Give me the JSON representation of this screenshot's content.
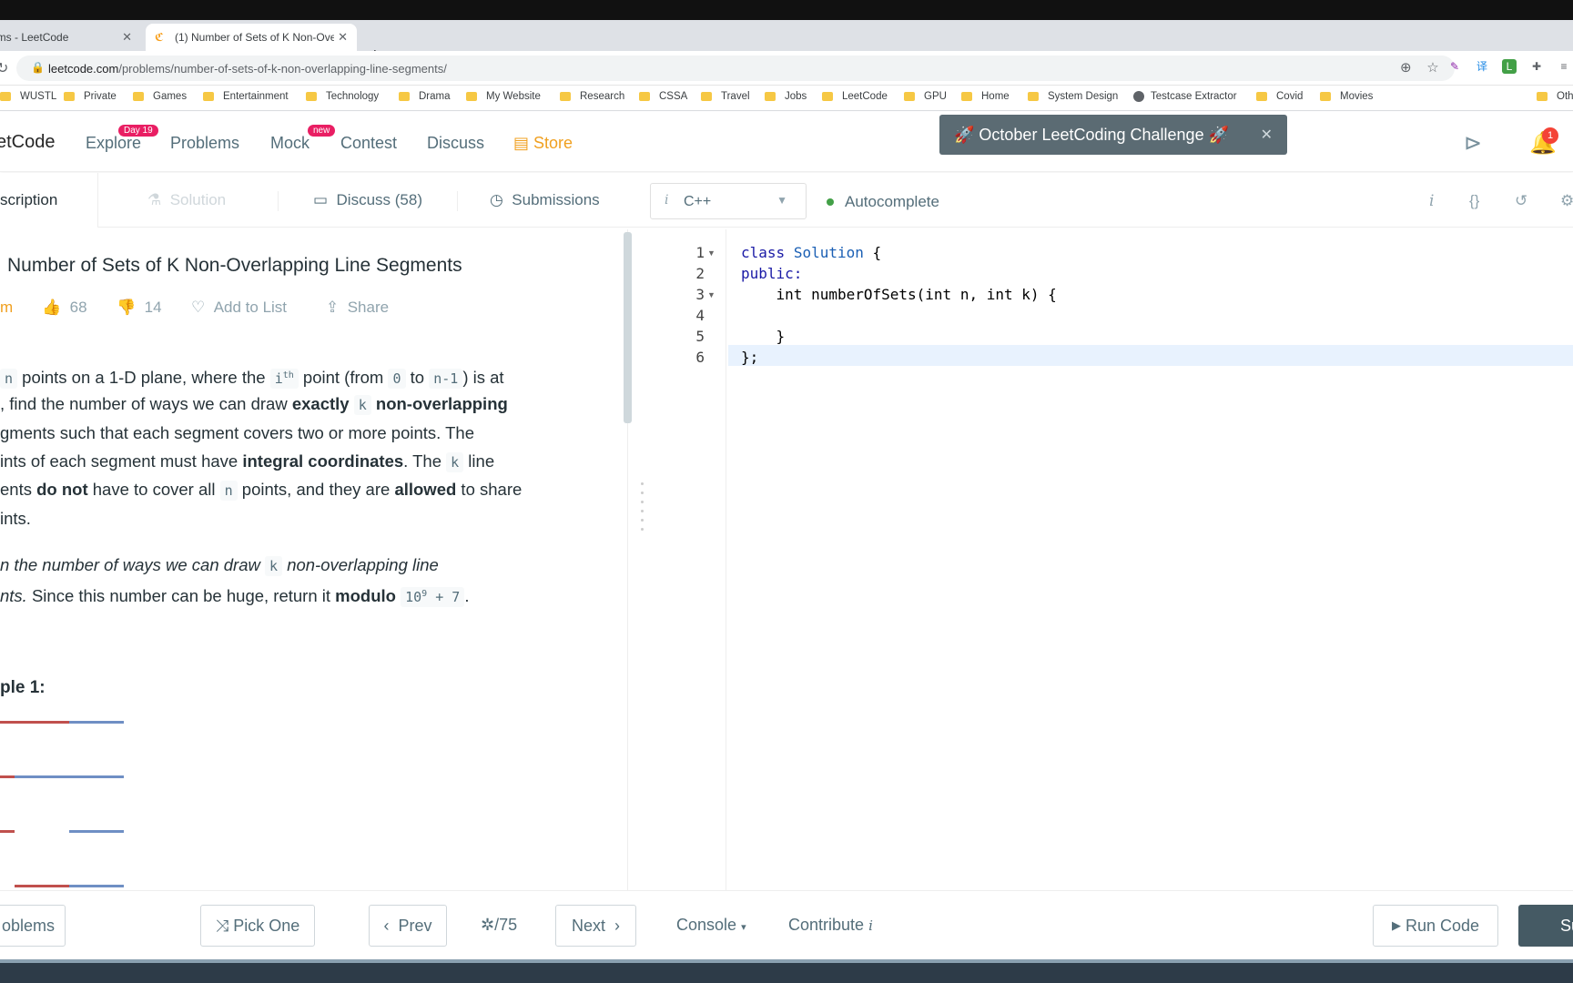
{
  "browser": {
    "tabs": [
      {
        "title": "ems - LeetCode",
        "active": false
      },
      {
        "title": "(1) Number of Sets of K Non-Ove",
        "active": true
      }
    ],
    "url_domain": "leetcode.com",
    "url_path": "/problems/number-of-sets-of-k-non-overlapping-line-segments/",
    "bookmarks": [
      "WUSTL",
      "Private",
      "Games",
      "Entertainment",
      "Technology",
      "Drama",
      "My Website",
      "Research",
      "CSSA",
      "Travel",
      "Jobs",
      "LeetCode",
      "GPU",
      "Home",
      "System Design",
      "Testcase Extractor",
      "Covid",
      "Movies",
      "Oth"
    ]
  },
  "nav": {
    "logo": "etCode",
    "items": [
      "Explore",
      "Problems",
      "Mock",
      "Contest",
      "Discuss"
    ],
    "explore_badge": "Day 19",
    "mock_badge": "new",
    "store": "Store",
    "banner": "🚀 October LeetCoding Challenge 🚀",
    "notifications": "1"
  },
  "tabs": {
    "description": "scription",
    "solution": "Solution",
    "discuss": "Discuss (58)",
    "submissions": "Submissions",
    "language": "C++",
    "autocomplete": "Autocomplete"
  },
  "problem": {
    "title": "Number of Sets of K Non-Overlapping Line Segments",
    "difficulty": "m",
    "likes": "68",
    "dislikes": "14",
    "add_to_list": "Add to List",
    "share": "Share",
    "example_label": "ple 1:"
  },
  "editor": {
    "lines": [
      "1",
      "2",
      "3",
      "4",
      "5",
      "6"
    ],
    "code": [
      "class Solution {",
      "public:",
      "    int numberOfSets(int n, int k) {",
      "",
      "    }",
      "};"
    ]
  },
  "footer": {
    "problems": "oblems",
    "pick_one": "Pick One",
    "prev": "Prev",
    "page": "/75",
    "next": "Next",
    "console": "Console",
    "contribute": "Contribute",
    "run_code": "Run Code",
    "submit": "Sub"
  },
  "colors": {
    "accent": "#f0a020",
    "badge": "#e91e63",
    "banner": "#5b6b73",
    "submit": "#455a64"
  }
}
